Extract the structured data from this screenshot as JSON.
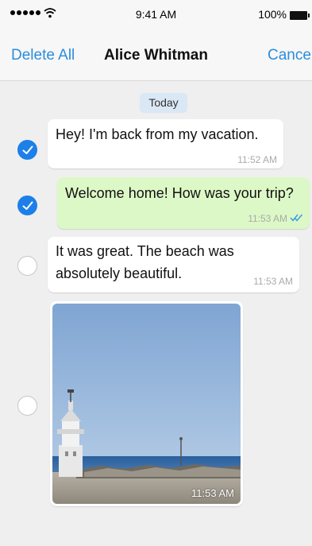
{
  "status_bar": {
    "time": "9:41 AM",
    "battery_percent": "100%",
    "signal_bars": 5,
    "icons": [
      "signal-dots-icon",
      "wifi-icon",
      "battery-icon"
    ]
  },
  "nav": {
    "left_action": "Delete All",
    "title": "Alice Whitman",
    "right_action": "Cancel"
  },
  "chat": {
    "date_separator": "Today",
    "messages": [
      {
        "direction": "incoming",
        "text": "Hey! I'm back from my vacation.",
        "time": "11:52 AM",
        "selected": true
      },
      {
        "direction": "outgoing",
        "text": "Welcome home! How was your trip?",
        "time": "11:53 AM",
        "read_receipt": "double-check-icon",
        "selected": true
      },
      {
        "direction": "incoming",
        "text_line1": "It was great. The beach was",
        "text_line2": "absolutely beautiful.",
        "time": "11:53 AM",
        "selected": false
      },
      {
        "direction": "incoming",
        "type": "photo",
        "photo_subject": "lighthouse-beach-photo",
        "time": "11:53 AM",
        "selected": false
      }
    ]
  },
  "colors": {
    "accent": "#2a8ddc",
    "check_selected": "#1d7fe8",
    "outgoing_bubble": "#dcf8c6",
    "incoming_bubble": "#ffffff",
    "chat_background": "#efefef",
    "date_pill": "#dae7f5"
  }
}
